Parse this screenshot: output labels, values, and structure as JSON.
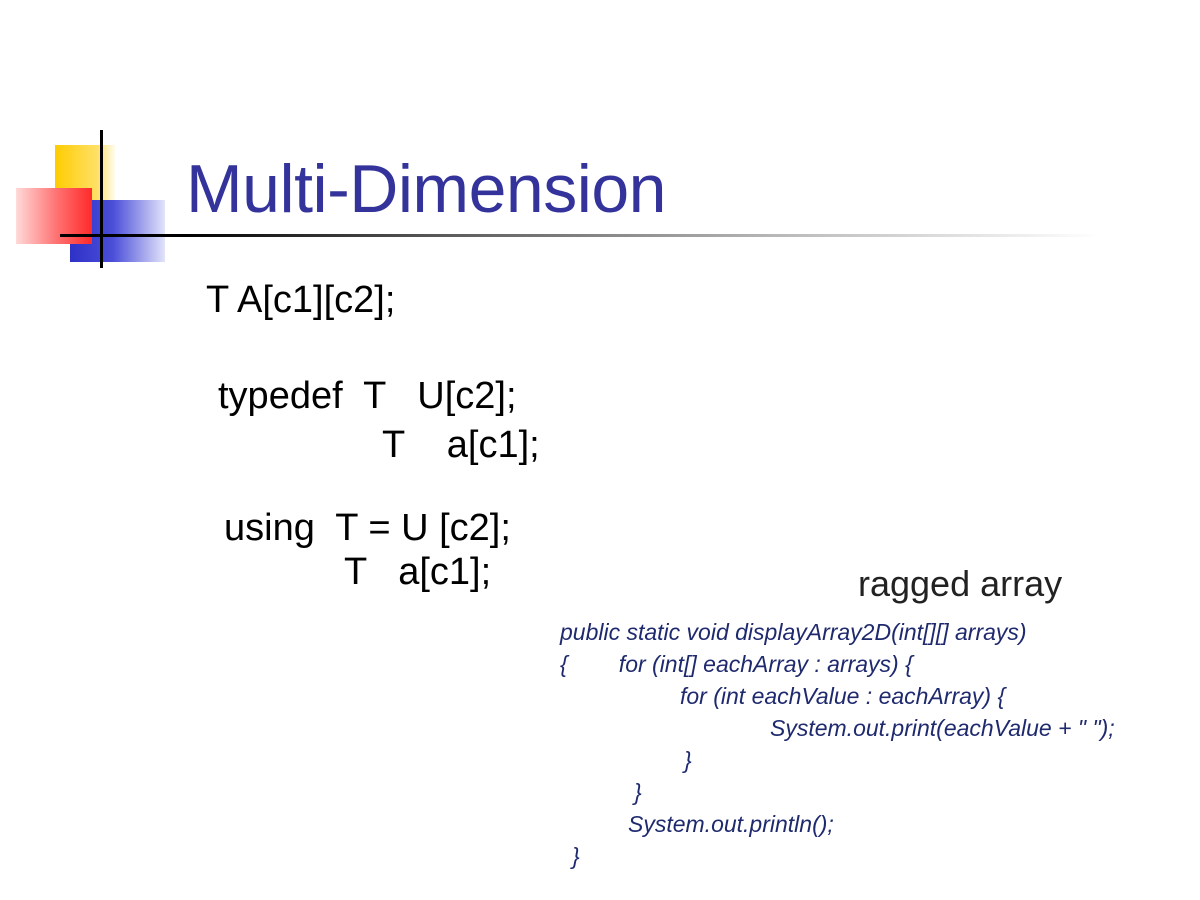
{
  "slide": {
    "title": "Multi-Dimension",
    "declarations": [
      "T A[c1][c2];",
      "typedef  T   U[c2];",
      "T    a[c1];",
      "using  T = U [c2];",
      "T   a[c1];"
    ],
    "side_label": "ragged array",
    "code_lines": [
      "public static void displayArray2D(int[][] arrays)",
      "{        for (int[] eachArray : arrays) {",
      "for (int eachValue : eachArray) {",
      "System.out.print(eachValue + \" \");",
      "}",
      "}",
      "System.out.println();",
      "}"
    ]
  },
  "colors": {
    "title": "#33339b",
    "code": "#1f2a6e",
    "logo_yellow": "#ffcc00",
    "logo_red": "#ff2a2a",
    "logo_blue": "#2e31c7"
  }
}
